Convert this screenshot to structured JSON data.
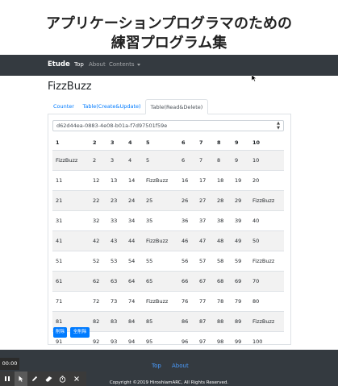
{
  "page": {
    "title_line1": "アプリケーションプログラマのための",
    "title_line2": "練習プログラム集"
  },
  "navbar": {
    "brand": "Etude",
    "links": [
      "Top",
      "About",
      "Contents"
    ]
  },
  "content": {
    "heading": "FizzBuzz",
    "tabs": [
      "Counter",
      "Table(Create&Update)",
      "Table(Read&Delete)"
    ],
    "active_tab": "Table(Read&Delete)",
    "select_value": "d62d44ea-0883-4e08-b01a-f7d97501f59e",
    "table": {
      "headers": [
        "1",
        "2",
        "3",
        "4",
        "5",
        "6",
        "7",
        "8",
        "9",
        "10"
      ],
      "rows": [
        [
          "FizzBuzz",
          "2",
          "3",
          "4",
          "5",
          "6",
          "7",
          "8",
          "9",
          "10"
        ],
        [
          "11",
          "12",
          "13",
          "14",
          "FizzBuzz",
          "16",
          "17",
          "18",
          "19",
          "20"
        ],
        [
          "21",
          "22",
          "23",
          "24",
          "25",
          "26",
          "27",
          "28",
          "29",
          "FizzBuzz"
        ],
        [
          "31",
          "32",
          "33",
          "34",
          "35",
          "36",
          "37",
          "38",
          "39",
          "40"
        ],
        [
          "41",
          "42",
          "43",
          "44",
          "FizzBuzz",
          "46",
          "47",
          "48",
          "49",
          "50"
        ],
        [
          "51",
          "52",
          "53",
          "54",
          "55",
          "56",
          "57",
          "58",
          "59",
          "FizzBuzz"
        ],
        [
          "61",
          "62",
          "63",
          "64",
          "65",
          "66",
          "67",
          "68",
          "69",
          "70"
        ],
        [
          "71",
          "72",
          "73",
          "74",
          "FizzBuzz",
          "76",
          "77",
          "78",
          "79",
          "80"
        ],
        [
          "81",
          "82",
          "83",
          "84",
          "85",
          "86",
          "87",
          "88",
          "89",
          "FizzBuzz"
        ],
        [
          "91",
          "92",
          "93",
          "94",
          "95",
          "96",
          "97",
          "98",
          "99",
          "100"
        ]
      ]
    },
    "buttons": {
      "delete": "削除",
      "delete_all": "全削除"
    }
  },
  "footer": {
    "links": [
      "Top",
      "About"
    ],
    "copyright": "Copyright ©2019 HiroshiamARC, All Rights Reserved."
  },
  "recorder": {
    "time": "00:00",
    "tools": [
      "pause-icon",
      "pointer-icon",
      "pen-icon",
      "eraser-icon",
      "timer-icon",
      "close-icon"
    ]
  },
  "colors": {
    "navbar_bg": "#343a40",
    "link": "#007bff",
    "button_bg": "#007bff",
    "striped_row": "#f2f2f2"
  }
}
